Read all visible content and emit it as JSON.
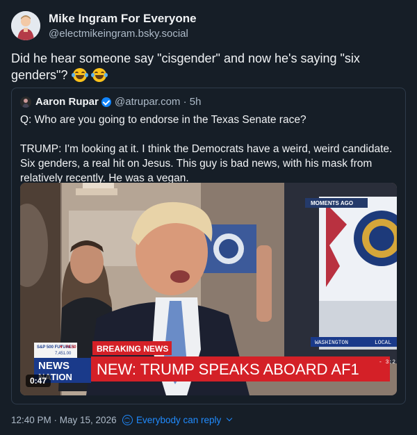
{
  "author": {
    "name": "Mike Ingram For Everyone",
    "handle": "@electmikeingram.bsky.social"
  },
  "post": {
    "text": "Did he hear someone say \"cisgender\" and now he's saying \"six genders\"?",
    "emojis": [
      "laughing-tears-emoji",
      "laughing-tears-emoji"
    ]
  },
  "quote": {
    "author_name": "Aaron Rupar",
    "handle_time": "@atrupar.com · 5h",
    "verified": true,
    "paragraphs": [
      "Q: Who are you going to endorse in the Texas Senate race?",
      "TRUMP: I'm looking at it. I think the Democrats have a weird, weird candidate. Six genders, a real hit on Jesus. This guy is bad news, with his mask from relatively recently. He was a vegan."
    ],
    "video": {
      "duration": "0:47",
      "moments_ago": "MOMENTS AGO",
      "breaking": "BREAKING NEWS",
      "headline": "NEW: TRUMP SPEAKS ABOARD AF1",
      "ticker_label": "S&P 500 FUTURES",
      "ticker_change": "▼ -74.50",
      "ticker_value": "7,451.00",
      "network_top": "NEWS",
      "network_bottom": "NATION",
      "location": "WASHINGTON",
      "local": "LOCAL",
      "temp": "- 3:2"
    }
  },
  "footer": {
    "timestamp": "12:40 PM · May 15, 2026",
    "reply_setting": "Everybody can reply"
  },
  "colors": {
    "background": "#161e27",
    "link": "#208bfe",
    "secondary_text": "#aebbc9",
    "breaking_red": "#d42027"
  }
}
